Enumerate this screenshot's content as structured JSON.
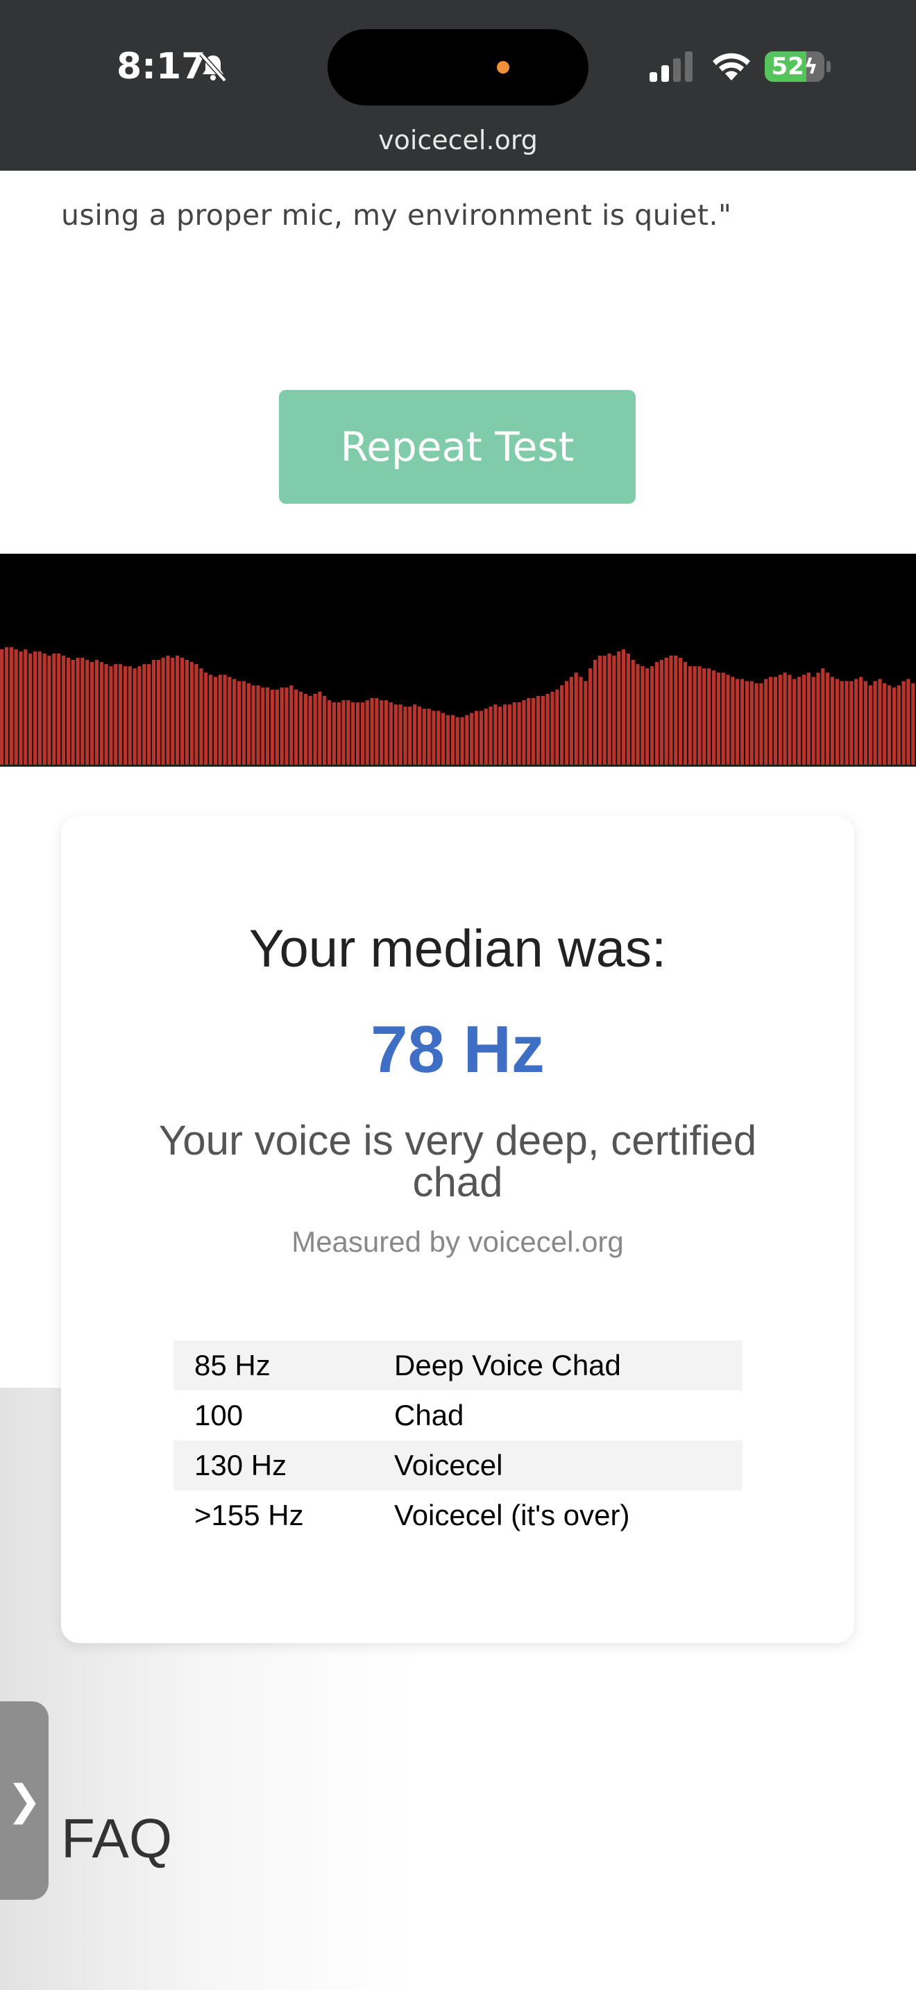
{
  "status_bar": {
    "time": "8:17",
    "battery": "52",
    "icons": [
      "bell-slash-icon",
      "signal-icon",
      "wifi-icon",
      "battery-charging-icon"
    ]
  },
  "browser": {
    "url": "voicecel.org"
  },
  "page": {
    "intro_tail": "using a proper mic, my environment is quiet.\"",
    "repeat_button": "Repeat Test",
    "visualizer": {
      "bar_color": "#b8342c",
      "levels": [
        0.55,
        0.56,
        0.56,
        0.55,
        0.54,
        0.55,
        0.53,
        0.54,
        0.54,
        0.53,
        0.52,
        0.53,
        0.53,
        0.52,
        0.51,
        0.5,
        0.51,
        0.51,
        0.5,
        0.49,
        0.5,
        0.49,
        0.48,
        0.47,
        0.48,
        0.48,
        0.47,
        0.47,
        0.46,
        0.47,
        0.48,
        0.48,
        0.5,
        0.5,
        0.51,
        0.52,
        0.51,
        0.52,
        0.51,
        0.5,
        0.49,
        0.48,
        0.46,
        0.44,
        0.43,
        0.42,
        0.43,
        0.43,
        0.42,
        0.41,
        0.4,
        0.4,
        0.39,
        0.38,
        0.38,
        0.37,
        0.37,
        0.36,
        0.36,
        0.37,
        0.37,
        0.38,
        0.36,
        0.35,
        0.34,
        0.33,
        0.34,
        0.35,
        0.33,
        0.31,
        0.3,
        0.3,
        0.31,
        0.31,
        0.3,
        0.3,
        0.3,
        0.31,
        0.32,
        0.32,
        0.31,
        0.31,
        0.3,
        0.29,
        0.29,
        0.28,
        0.28,
        0.29,
        0.28,
        0.27,
        0.27,
        0.26,
        0.26,
        0.25,
        0.24,
        0.24,
        0.23,
        0.23,
        0.24,
        0.25,
        0.26,
        0.26,
        0.27,
        0.28,
        0.29,
        0.28,
        0.29,
        0.29,
        0.3,
        0.3,
        0.31,
        0.32,
        0.32,
        0.33,
        0.33,
        0.34,
        0.35,
        0.36,
        0.38,
        0.4,
        0.42,
        0.44,
        0.42,
        0.4,
        0.46,
        0.5,
        0.52,
        0.52,
        0.53,
        0.52,
        0.54,
        0.55,
        0.53,
        0.5,
        0.48,
        0.47,
        0.46,
        0.47,
        0.49,
        0.5,
        0.51,
        0.52,
        0.52,
        0.51,
        0.49,
        0.47,
        0.47,
        0.47,
        0.46,
        0.46,
        0.45,
        0.44,
        0.44,
        0.43,
        0.42,
        0.41,
        0.41,
        0.4,
        0.4,
        0.39,
        0.39,
        0.41,
        0.42,
        0.42,
        0.43,
        0.44,
        0.43,
        0.41,
        0.42,
        0.43,
        0.44,
        0.42,
        0.44,
        0.46,
        0.44,
        0.42,
        0.41,
        0.4,
        0.4,
        0.4,
        0.41,
        0.42,
        0.4,
        0.38,
        0.4,
        0.41,
        0.39,
        0.38,
        0.37,
        0.38,
        0.4,
        0.41,
        0.39
      ]
    },
    "result_card": {
      "title": "Your median was:",
      "value": "78 Hz",
      "value_color": "#3e6fc4",
      "description": "Your voice is very deep, certified chad",
      "credit": "Measured by voicecel.org",
      "table": [
        {
          "freq": "85 Hz",
          "label": "Deep Voice Chad"
        },
        {
          "freq": "100",
          "label": "Chad"
        },
        {
          "freq": "130 Hz",
          "label": "Voicecel"
        },
        {
          "freq": ">155 Hz",
          "label": "Voicecel (it's over)"
        }
      ]
    },
    "side_tab_icon": "chevron-right-icon",
    "side_tab_glyph": "❯",
    "faq_heading": "FAQ"
  }
}
